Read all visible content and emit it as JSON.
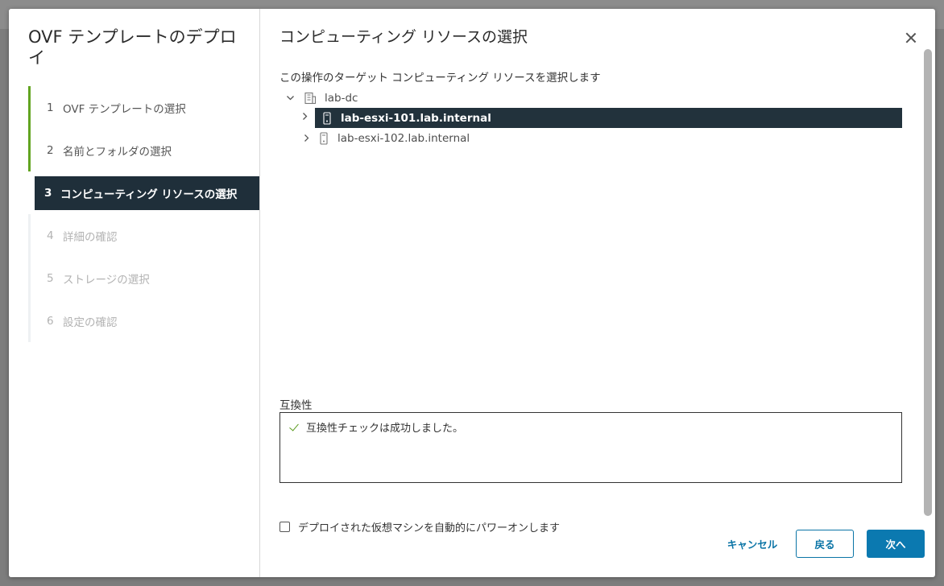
{
  "wizard": {
    "title": "OVF テンプレートのデプロイ",
    "steps": [
      {
        "num": "1",
        "label": "OVF テンプレートの選択",
        "state": "done"
      },
      {
        "num": "2",
        "label": "名前とフォルダの選択",
        "state": "done"
      },
      {
        "num": "3",
        "label": "コンピューティング リソースの選択",
        "state": "active"
      },
      {
        "num": "4",
        "label": "詳細の確認",
        "state": "future"
      },
      {
        "num": "5",
        "label": "ストレージの選択",
        "state": "future"
      },
      {
        "num": "6",
        "label": "設定の確認",
        "state": "future"
      }
    ]
  },
  "content": {
    "title": "コンピューティング リソースの選択",
    "instruction": "この操作のターゲット コンピューティング リソースを選択します",
    "tree": {
      "datacenter": "lab-dc",
      "hosts": [
        {
          "label": "lab-esxi-101.lab.internal",
          "selected": true
        },
        {
          "label": "lab-esxi-102.lab.internal",
          "selected": false
        }
      ]
    },
    "compat": {
      "label": "互換性",
      "message": "互換性チェックは成功しました。"
    },
    "power_on_label": "デプロイされた仮想マシンを自動的にパワーオンします"
  },
  "footer": {
    "cancel": "キャンセル",
    "back": "戻る",
    "next": "次へ"
  },
  "colors": {
    "accent": "#0b79b0",
    "active_step_bg": "#1f2f3a",
    "done_bar": "#62a420",
    "check_green": "#5a9b1d"
  }
}
